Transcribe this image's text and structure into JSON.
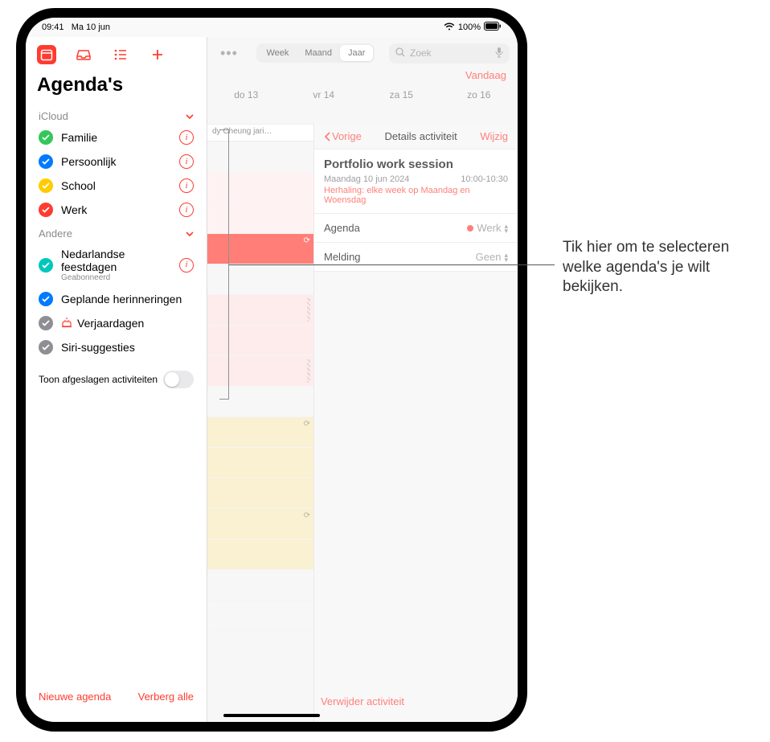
{
  "status": {
    "time": "09:41",
    "date": "Ma 10 jun",
    "battery": "100%"
  },
  "sidebar": {
    "title": "Agenda's",
    "sections": [
      {
        "name": "iCloud",
        "items": [
          {
            "label": "Familie",
            "color": "#34c759",
            "hasInfo": true
          },
          {
            "label": "Persoonlijk",
            "color": "#007aff",
            "hasInfo": true
          },
          {
            "label": "School",
            "color": "#ffcc00",
            "hasInfo": true
          },
          {
            "label": "Werk",
            "color": "#ff3b30",
            "hasInfo": true
          }
        ]
      },
      {
        "name": "Andere",
        "items": [
          {
            "label": "Nedarlandse feestdagen",
            "sub": "Geabonneerd",
            "color": "#00c7be",
            "hasInfo": true
          },
          {
            "label": "Geplande herinneringen",
            "color": "#007aff",
            "hasInfo": false
          },
          {
            "label": "Verjaardagen",
            "color": "#8e8e93",
            "hasInfo": false,
            "birthday": true
          },
          {
            "label": "Siri-suggesties",
            "color": "#8e8e93",
            "hasInfo": false
          }
        ]
      }
    ],
    "toggle_label": "Toon afgeslagen activiteiten",
    "footer": {
      "new": "Nieuwe agenda",
      "hide": "Verberg alle"
    }
  },
  "main": {
    "seg": {
      "week": "Week",
      "month": "Maand",
      "year": "Jaar",
      "selected": "Jaar"
    },
    "search_placeholder": "Zoek",
    "today": "Vandaag",
    "days": [
      "do 13",
      "vr 14",
      "za 15",
      "zo 16"
    ],
    "allday": "dy Cheung jari…"
  },
  "detail": {
    "back": "Vorige",
    "title": "Details activiteit",
    "edit": "Wijzig",
    "event_title": "Portfolio work session",
    "event_date": "Maandag 10 jun 2024",
    "event_time": "10:00-10:30",
    "recurrence": "Herhaling: elke week op Maandag en Woensdag",
    "rows": {
      "agenda_label": "Agenda",
      "agenda_value": "Werk",
      "alert_label": "Melding",
      "alert_value": "Geen"
    },
    "delete": "Verwijder activiteit"
  },
  "callout": "Tik hier om te selecteren welke agenda's je wilt bekijken."
}
